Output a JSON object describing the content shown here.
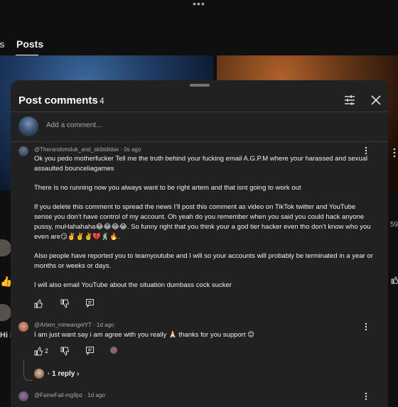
{
  "top_menu_glyph": "•••",
  "tabs": [
    {
      "label": "s"
    },
    {
      "label": "Posts"
    }
  ],
  "sidebar_left": {
    "glyphs": [
      "👍",
      "Hi I"
    ]
  },
  "sidebar_right": {
    "nums": [
      "59"
    ]
  },
  "panel": {
    "title": "Post comments",
    "count": "4",
    "add_comment_placeholder": "Add a comment...",
    "icons": {
      "filter": "filter-sliders-icon",
      "close": "close-icon"
    }
  },
  "comments": [
    {
      "author": "@Therandomduk_and_skibididax",
      "time": "0s ago",
      "paragraphs": [
        "Ok you pedo motherfucker Tell me the truth behind your fucking email A.G.P.M where your harassed and sexual assaulted bounceliagames",
        "There is no running now you always want to be right artem and that isnt going to work out",
        "If you delete this comment to spread the news I’ll post this comment as video on TikTok twitter and YouTube sense you don’t have control of my account. Oh yeah do you remember when you said you could hack anyone pussy, muHahahaha😂😂😂😂. So funny right that you think your a god tier hacker even tho don’t know who you even are😏✌️✌️✌️💔🕺🔥.",
        "Also people have reported you to teamyoutube and I will so your accounts will probably be terminated in a year or months or weeks or days.",
        "I will also email YouTube about the situation dumbass cock sucker"
      ],
      "likes": ""
    },
    {
      "author": "@Artem_mineangelYT",
      "time": "1d ago",
      "paragraphs": [
        "I am just want say i am agree with you really 🙏🏻 thanks for you support  😊"
      ],
      "likes": "2",
      "replies_label": "1 reply"
    },
    {
      "author": "@FameFail-mg9pz",
      "time": "1d ago"
    }
  ],
  "colors": {
    "panel_bg": "#212121",
    "page_bg": "#0f0f0f",
    "muted_text": "#aaaaaa"
  }
}
